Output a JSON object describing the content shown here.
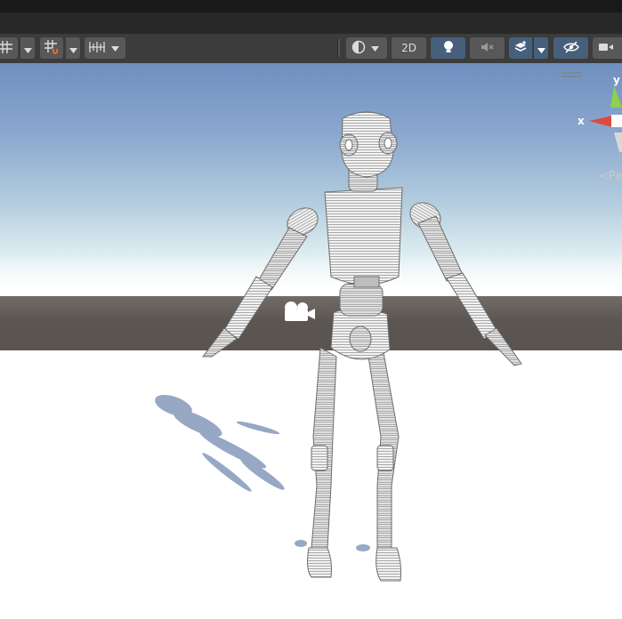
{
  "toolbar": {
    "grid_label": "",
    "snap_label": "",
    "increment_label": "",
    "shading_label": "",
    "mode_2d_label": "2D",
    "lighting_label": "",
    "audio_label": "",
    "effects_label": "",
    "visibility_label": "",
    "camera_label": ""
  },
  "gizmo": {
    "x_label": "x",
    "y_label": "y",
    "projection_label": "Pe"
  },
  "colors": {
    "toolbar_bg": "#3c3c3c",
    "button_bg": "#585858",
    "active_button_bg": "#46607c",
    "snap_accent": "#e86a2c",
    "axis_x": "#e04a3a",
    "axis_y": "#8fd14a"
  }
}
